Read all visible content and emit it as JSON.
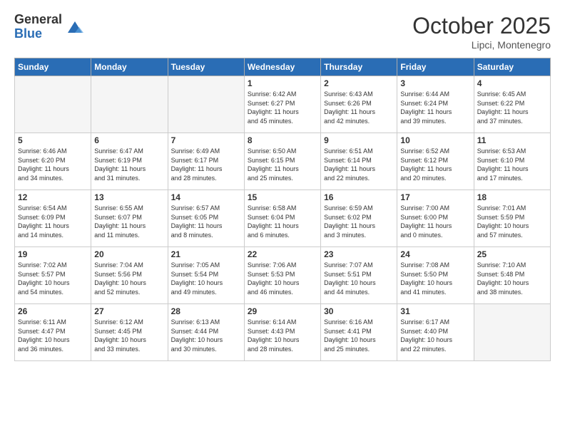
{
  "header": {
    "logo_general": "General",
    "logo_blue": "Blue",
    "month_title": "October 2025",
    "location": "Lipci, Montenegro"
  },
  "days_of_week": [
    "Sunday",
    "Monday",
    "Tuesday",
    "Wednesday",
    "Thursday",
    "Friday",
    "Saturday"
  ],
  "weeks": [
    [
      {
        "day": "",
        "info": ""
      },
      {
        "day": "",
        "info": ""
      },
      {
        "day": "",
        "info": ""
      },
      {
        "day": "1",
        "info": "Sunrise: 6:42 AM\nSunset: 6:27 PM\nDaylight: 11 hours\nand 45 minutes."
      },
      {
        "day": "2",
        "info": "Sunrise: 6:43 AM\nSunset: 6:26 PM\nDaylight: 11 hours\nand 42 minutes."
      },
      {
        "day": "3",
        "info": "Sunrise: 6:44 AM\nSunset: 6:24 PM\nDaylight: 11 hours\nand 39 minutes."
      },
      {
        "day": "4",
        "info": "Sunrise: 6:45 AM\nSunset: 6:22 PM\nDaylight: 11 hours\nand 37 minutes."
      }
    ],
    [
      {
        "day": "5",
        "info": "Sunrise: 6:46 AM\nSunset: 6:20 PM\nDaylight: 11 hours\nand 34 minutes."
      },
      {
        "day": "6",
        "info": "Sunrise: 6:47 AM\nSunset: 6:19 PM\nDaylight: 11 hours\nand 31 minutes."
      },
      {
        "day": "7",
        "info": "Sunrise: 6:49 AM\nSunset: 6:17 PM\nDaylight: 11 hours\nand 28 minutes."
      },
      {
        "day": "8",
        "info": "Sunrise: 6:50 AM\nSunset: 6:15 PM\nDaylight: 11 hours\nand 25 minutes."
      },
      {
        "day": "9",
        "info": "Sunrise: 6:51 AM\nSunset: 6:14 PM\nDaylight: 11 hours\nand 22 minutes."
      },
      {
        "day": "10",
        "info": "Sunrise: 6:52 AM\nSunset: 6:12 PM\nDaylight: 11 hours\nand 20 minutes."
      },
      {
        "day": "11",
        "info": "Sunrise: 6:53 AM\nSunset: 6:10 PM\nDaylight: 11 hours\nand 17 minutes."
      }
    ],
    [
      {
        "day": "12",
        "info": "Sunrise: 6:54 AM\nSunset: 6:09 PM\nDaylight: 11 hours\nand 14 minutes."
      },
      {
        "day": "13",
        "info": "Sunrise: 6:55 AM\nSunset: 6:07 PM\nDaylight: 11 hours\nand 11 minutes."
      },
      {
        "day": "14",
        "info": "Sunrise: 6:57 AM\nSunset: 6:05 PM\nDaylight: 11 hours\nand 8 minutes."
      },
      {
        "day": "15",
        "info": "Sunrise: 6:58 AM\nSunset: 6:04 PM\nDaylight: 11 hours\nand 6 minutes."
      },
      {
        "day": "16",
        "info": "Sunrise: 6:59 AM\nSunset: 6:02 PM\nDaylight: 11 hours\nand 3 minutes."
      },
      {
        "day": "17",
        "info": "Sunrise: 7:00 AM\nSunset: 6:00 PM\nDaylight: 11 hours\nand 0 minutes."
      },
      {
        "day": "18",
        "info": "Sunrise: 7:01 AM\nSunset: 5:59 PM\nDaylight: 10 hours\nand 57 minutes."
      }
    ],
    [
      {
        "day": "19",
        "info": "Sunrise: 7:02 AM\nSunset: 5:57 PM\nDaylight: 10 hours\nand 54 minutes."
      },
      {
        "day": "20",
        "info": "Sunrise: 7:04 AM\nSunset: 5:56 PM\nDaylight: 10 hours\nand 52 minutes."
      },
      {
        "day": "21",
        "info": "Sunrise: 7:05 AM\nSunset: 5:54 PM\nDaylight: 10 hours\nand 49 minutes."
      },
      {
        "day": "22",
        "info": "Sunrise: 7:06 AM\nSunset: 5:53 PM\nDaylight: 10 hours\nand 46 minutes."
      },
      {
        "day": "23",
        "info": "Sunrise: 7:07 AM\nSunset: 5:51 PM\nDaylight: 10 hours\nand 44 minutes."
      },
      {
        "day": "24",
        "info": "Sunrise: 7:08 AM\nSunset: 5:50 PM\nDaylight: 10 hours\nand 41 minutes."
      },
      {
        "day": "25",
        "info": "Sunrise: 7:10 AM\nSunset: 5:48 PM\nDaylight: 10 hours\nand 38 minutes."
      }
    ],
    [
      {
        "day": "26",
        "info": "Sunrise: 6:11 AM\nSunset: 4:47 PM\nDaylight: 10 hours\nand 36 minutes."
      },
      {
        "day": "27",
        "info": "Sunrise: 6:12 AM\nSunset: 4:45 PM\nDaylight: 10 hours\nand 33 minutes."
      },
      {
        "day": "28",
        "info": "Sunrise: 6:13 AM\nSunset: 4:44 PM\nDaylight: 10 hours\nand 30 minutes."
      },
      {
        "day": "29",
        "info": "Sunrise: 6:14 AM\nSunset: 4:43 PM\nDaylight: 10 hours\nand 28 minutes."
      },
      {
        "day": "30",
        "info": "Sunrise: 6:16 AM\nSunset: 4:41 PM\nDaylight: 10 hours\nand 25 minutes."
      },
      {
        "day": "31",
        "info": "Sunrise: 6:17 AM\nSunset: 4:40 PM\nDaylight: 10 hours\nand 22 minutes."
      },
      {
        "day": "",
        "info": ""
      }
    ]
  ]
}
